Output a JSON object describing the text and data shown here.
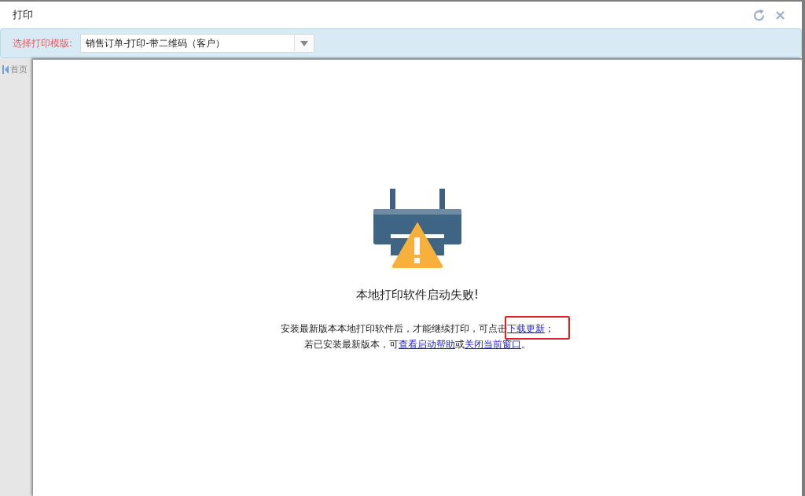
{
  "window": {
    "title": "打印",
    "buttons": [
      {
        "kind": "refresh"
      },
      {
        "kind": "close"
      }
    ]
  },
  "toolbar": {
    "label": "选择打印模版:",
    "template": "销售订单-打印-带二维码（客户）"
  },
  "background_tab": {
    "label": "首页"
  },
  "message": {
    "title": "本地打印软件启动失败!",
    "lines": [
      [
        {
          "text": "安装最新版本本地打印软件后，才能继续打印，可点击"
        },
        {
          "text": "下载更新",
          "link": true,
          "highlighted": true
        },
        {
          "text": "；"
        }
      ],
      [
        {
          "text": "若已安装最新版本，可"
        },
        {
          "text": "查看启动帮助",
          "link": true,
          "highlighted": false
        },
        {
          "text": "或"
        },
        {
          "text": "关闭当前窗口",
          "link": true,
          "highlighted": false
        },
        {
          "text": "。"
        }
      ]
    ]
  }
}
